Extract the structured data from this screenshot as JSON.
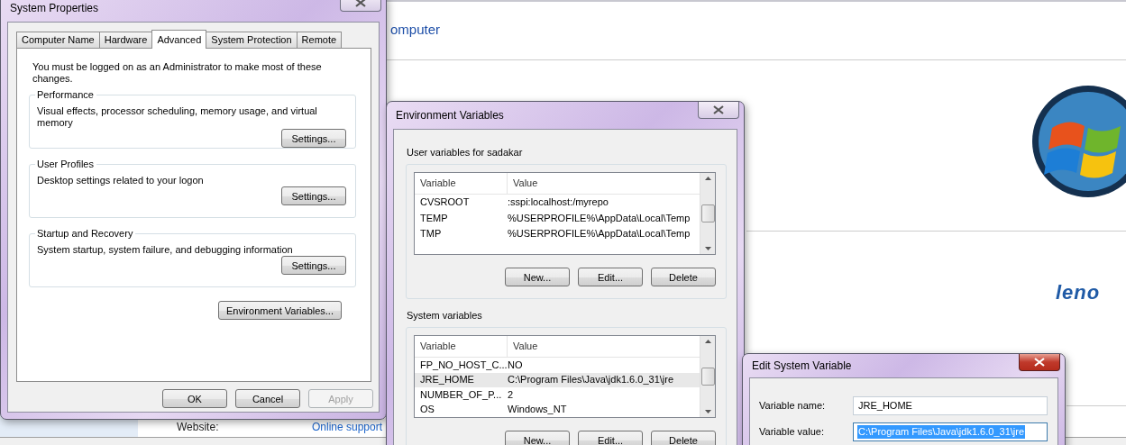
{
  "background_window": {
    "heading": "omputer",
    "brand": "leno",
    "website_label": "Website:",
    "website_link": "Online support"
  },
  "system_properties": {
    "title": "System Properties",
    "tabs": [
      {
        "label": "Computer Name",
        "selected": false
      },
      {
        "label": "Hardware",
        "selected": false
      },
      {
        "label": "Advanced",
        "selected": true
      },
      {
        "label": "System Protection",
        "selected": false
      },
      {
        "label": "Remote",
        "selected": false
      }
    ],
    "notice": "You must be logged on as an Administrator to make most of these changes.",
    "groups": [
      {
        "title": "Performance",
        "description": "Visual effects, processor scheduling, memory usage, and virtual memory",
        "button": "Settings..."
      },
      {
        "title": "User Profiles",
        "description": "Desktop settings related to your logon",
        "button": "Settings..."
      },
      {
        "title": "Startup and Recovery",
        "description": "System startup, system failure, and debugging information",
        "button": "Settings..."
      }
    ],
    "env_button": "Environment Variables...",
    "buttons": [
      {
        "label": "OK",
        "disabled": false
      },
      {
        "label": "Cancel",
        "disabled": false
      },
      {
        "label": "Apply",
        "disabled": true
      }
    ]
  },
  "environment_variables": {
    "title": "Environment Variables",
    "sections": [
      {
        "title": "User variables for sadakar",
        "columns": [
          "Variable",
          "Value"
        ],
        "rows": [
          {
            "variable": "CVSROOT",
            "value": ":sspi:localhost:/myrepo",
            "selected": false
          },
          {
            "variable": "TEMP",
            "value": "%USERPROFILE%\\AppData\\Local\\Temp",
            "selected": false
          },
          {
            "variable": "TMP",
            "value": "%USERPROFILE%\\AppData\\Local\\Temp",
            "selected": false
          }
        ],
        "buttons": [
          "New...",
          "Edit...",
          "Delete"
        ]
      },
      {
        "title": "System variables",
        "columns": [
          "Variable",
          "Value"
        ],
        "rows": [
          {
            "variable": "FP_NO_HOST_C...",
            "value": "NO",
            "selected": false
          },
          {
            "variable": "JRE_HOME",
            "value": "C:\\Program Files\\Java\\jdk1.6.0_31\\jre",
            "selected": true
          },
          {
            "variable": "NUMBER_OF_P...",
            "value": "2",
            "selected": false
          },
          {
            "variable": "OS",
            "value": "Windows_NT",
            "selected": false
          }
        ],
        "buttons": [
          "New...",
          "Edit...",
          "Delete"
        ]
      }
    ]
  },
  "edit_system_variable": {
    "title": "Edit System Variable",
    "fields": [
      {
        "label": "Variable name:",
        "value": "JRE_HOME",
        "text_selected": false
      },
      {
        "label": "Variable value:",
        "value": "C:\\Program Files\\Java\\jdk1.6.0_31\\jre",
        "text_selected": true
      }
    ]
  }
}
